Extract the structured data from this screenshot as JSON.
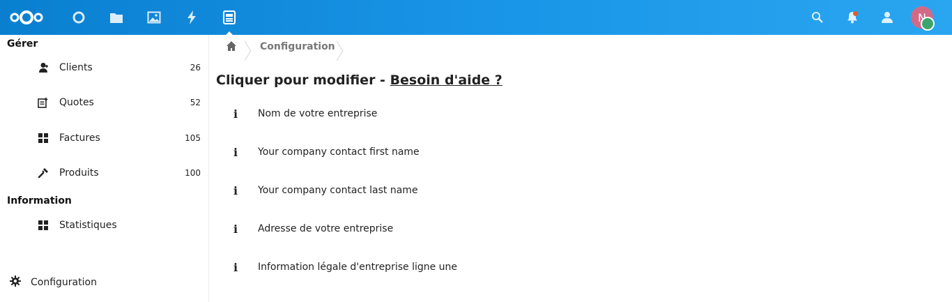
{
  "header": {
    "apps": [
      {
        "icon": "nextcloud-logo-icon"
      },
      {
        "icon": "dashboard-circle-icon"
      },
      {
        "icon": "files-folder-icon"
      },
      {
        "icon": "photos-image-icon"
      },
      {
        "icon": "activity-lightning-icon"
      },
      {
        "icon": "invoices-app-icon",
        "active": true
      }
    ],
    "right_icons": [
      "search-icon",
      "notifications-bell-icon",
      "contacts-icon"
    ],
    "avatar_initial": "N",
    "accent_color": "#0082c9",
    "status_color": "#3aa56c"
  },
  "sidebar": {
    "section_manage": "Gérer",
    "items": [
      {
        "label": "Clients",
        "count": "26",
        "icon": "clients-person-icon"
      },
      {
        "label": "Quotes",
        "count": "52",
        "icon": "quotes-document-icon"
      },
      {
        "label": "Factures",
        "count": "105",
        "icon": "invoices-grid-icon"
      },
      {
        "label": "Produits",
        "count": "100",
        "icon": "products-wrench-icon"
      }
    ],
    "section_info": "Information",
    "info_items": [
      {
        "label": "Statistiques",
        "icon": "statistics-grid-icon"
      }
    ],
    "settings_label": "Configuration"
  },
  "main": {
    "breadcrumb": {
      "current": "Configuration"
    },
    "title_prefix": "Cliquer pour modifier - ",
    "help_link": "Besoin d'aide ?",
    "fields": [
      "Nom de votre entreprise",
      "Your company contact first name",
      "Your company contact last name",
      "Adresse de votre entreprise",
      "Information légale d'entreprise ligne une"
    ],
    "info_glyph": "i"
  }
}
